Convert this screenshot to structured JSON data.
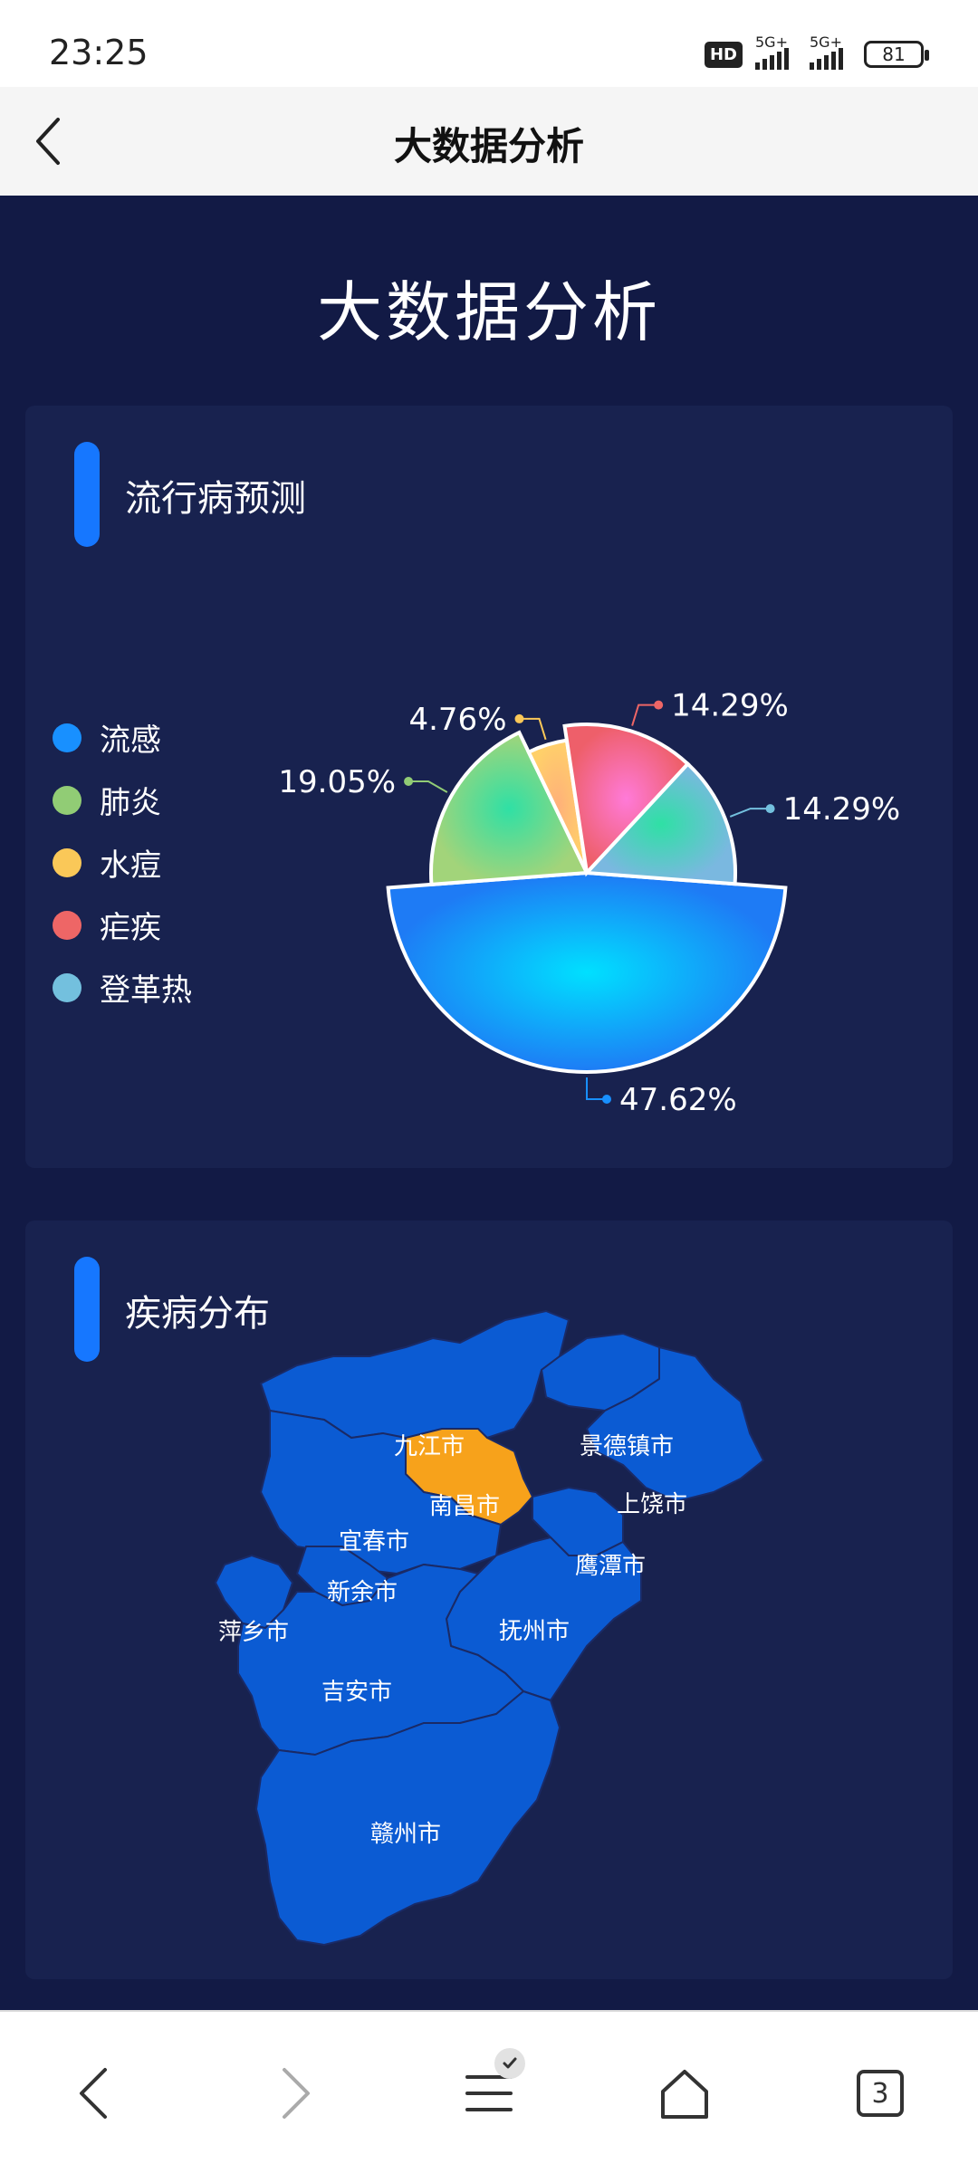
{
  "status_bar": {
    "time": "23:25",
    "hd_label": "HD",
    "network_1": "5G+",
    "network_2": "5G+",
    "battery": "81"
  },
  "header": {
    "title": "大数据分析",
    "back_icon": "chevron-left-icon"
  },
  "dashboard": {
    "title": "大数据分析",
    "pie_panel": {
      "title": "流行病预测",
      "legend": [
        {
          "label": "流感",
          "color": "#1890ff"
        },
        {
          "label": "肺炎",
          "color": "#91cc75"
        },
        {
          "label": "水痘",
          "color": "#fac858"
        },
        {
          "label": "疟疾",
          "color": "#ee6666"
        },
        {
          "label": "登革热",
          "color": "#73c0de"
        }
      ]
    },
    "map_panel": {
      "title": "疾病分布",
      "regions": [
        {
          "name": "九江市",
          "highlight": false
        },
        {
          "name": "景德镇市",
          "highlight": false
        },
        {
          "name": "南昌市",
          "highlight": true
        },
        {
          "name": "上饶市",
          "highlight": false
        },
        {
          "name": "宜春市",
          "highlight": false
        },
        {
          "name": "鹰潭市",
          "highlight": false
        },
        {
          "name": "新余市",
          "highlight": false
        },
        {
          "name": "萍乡市",
          "highlight": false
        },
        {
          "name": "抚州市",
          "highlight": false
        },
        {
          "name": "吉安市",
          "highlight": false
        },
        {
          "name": "赣州市",
          "highlight": false
        }
      ],
      "colors": {
        "region": "#0b5bd3",
        "highlight": "#f7a21b",
        "border": "#1a2a66"
      }
    }
  },
  "chart_data": {
    "type": "pie",
    "title": "",
    "series": [
      {
        "name": "流感",
        "value": 47.62,
        "label": "47.62%"
      },
      {
        "name": "肺炎",
        "value": 19.05,
        "label": "19.05%"
      },
      {
        "name": "水痘",
        "value": 4.76,
        "label": "4.76%"
      },
      {
        "name": "疟疾",
        "value": 14.29,
        "label": "14.29%"
      },
      {
        "name": "登革热",
        "value": 14.29,
        "label": "14.29%"
      }
    ],
    "style": "rose",
    "legend_position": "left"
  },
  "bottom_nav": {
    "tab_count": "3",
    "icons": [
      "back-icon",
      "forward-icon",
      "menu-icon",
      "home-icon",
      "tabs-icon"
    ]
  }
}
